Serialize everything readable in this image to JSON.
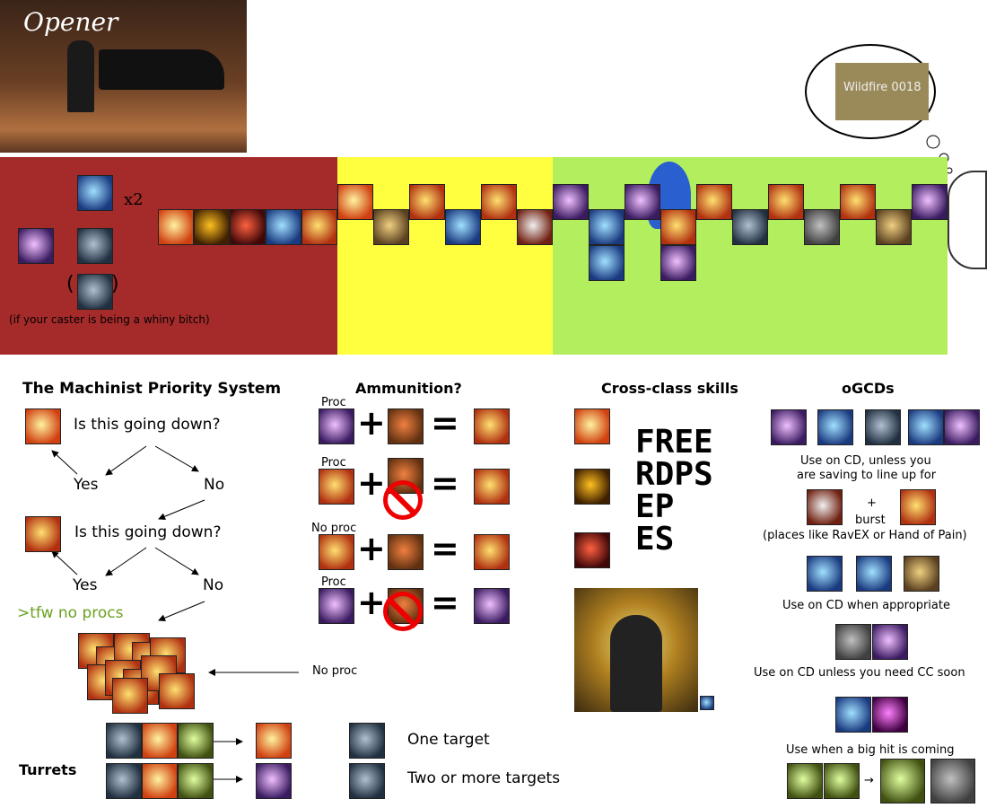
{
  "opener": {
    "title": "Opener",
    "multiplier": "x2",
    "caster_note": "(if your caster is being a whiny bitch)",
    "thought_bubble_text": "Wildfire 0018",
    "colors": {
      "red_phase": "#a52a2a",
      "yellow_phase": "#ffff3f",
      "green_phase": "#b3ee5f"
    }
  },
  "priority": {
    "title": "The Machinist Priority System",
    "q1": "Is this going down?",
    "q2": "Is this going down?",
    "yes1": "Yes",
    "no1": "No",
    "yes2": "Yes",
    "no2": "No",
    "no_procs": ">tfw no procs",
    "no_proc_label": "No proc",
    "no_procs_color": "#6aa121"
  },
  "ammunition": {
    "title": "Ammunition?",
    "rows": [
      {
        "label": "Proc",
        "plus": "+",
        "equals": "="
      },
      {
        "label": "Proc",
        "plus": "+",
        "equals": "="
      },
      {
        "label": "No proc",
        "plus": "+",
        "equals": "="
      },
      {
        "label": "Proc",
        "plus": "+",
        "equals": "="
      }
    ]
  },
  "cross_class": {
    "title": "Cross-class skills",
    "letters": "FREE\nRDPS\nEP\nES"
  },
  "turrets": {
    "title": "Turrets",
    "one_target": "One target",
    "two_targets": "Two or more targets"
  },
  "ogcds": {
    "title": "oGCDs",
    "note1_line1": "Use on CD, unless you",
    "note1_line2": "are saving to line up for",
    "plus": "+",
    "burst": "burst",
    "places": "(places like RavEX or Hand of Pain)",
    "note2": "Use on CD when appropriate",
    "note3": "Use on CD unless you need CC soon",
    "note4": "Use when a big hit is coming"
  }
}
